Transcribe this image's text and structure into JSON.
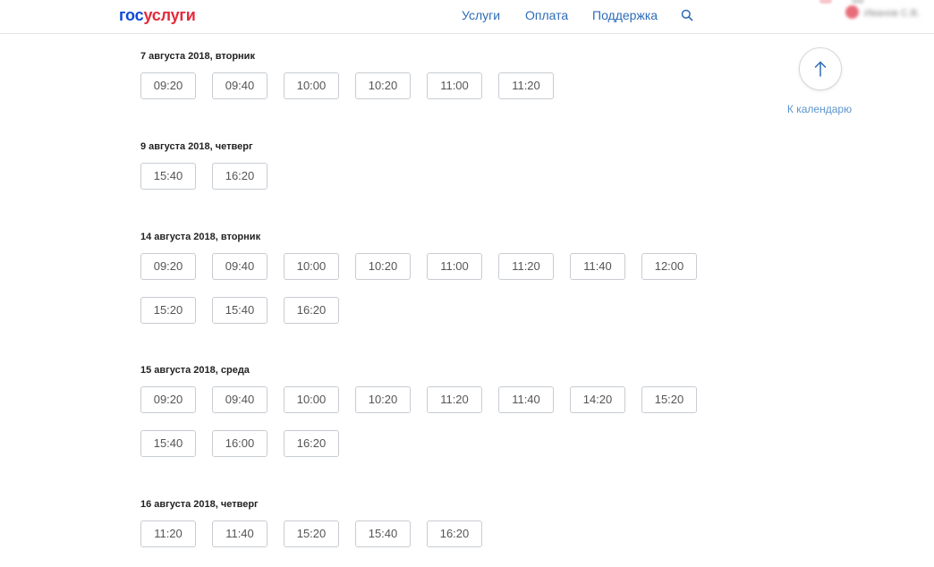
{
  "header": {
    "logo": {
      "part1": "гос",
      "part2": "услуги",
      "part3": ""
    },
    "nav": [
      {
        "label": "Услуги",
        "name": "nav-services"
      },
      {
        "label": "Оплата",
        "name": "nav-payment"
      },
      {
        "label": "Поддержка",
        "name": "nav-support"
      }
    ],
    "user_name": "Иванов С.В."
  },
  "to_calendar": {
    "label": "К календарю"
  },
  "days": [
    {
      "title": "7 августа 2018, вторник",
      "slots": [
        "09:20",
        "09:40",
        "10:00",
        "10:20",
        "11:00",
        "11:20"
      ]
    },
    {
      "title": "9 августа 2018, четверг",
      "slots": [
        "15:40",
        "16:20"
      ]
    },
    {
      "title": "14 августа 2018, вторник",
      "slots": [
        "09:20",
        "09:40",
        "10:00",
        "10:20",
        "11:00",
        "11:20",
        "11:40",
        "12:00",
        "15:20",
        "15:40",
        "16:20"
      ]
    },
    {
      "title": "15 августа 2018, среда",
      "slots": [
        "09:20",
        "09:40",
        "10:00",
        "10:20",
        "11:20",
        "11:40",
        "14:20",
        "15:20",
        "15:40",
        "16:00",
        "16:20"
      ]
    },
    {
      "title": "16 августа 2018, четверг",
      "slots": [
        "11:20",
        "11:40",
        "15:20",
        "15:40",
        "16:20"
      ]
    }
  ],
  "colors": {
    "brand_blue": "#0d4cd3",
    "brand_red": "#e5293a",
    "link": "#2d6bb6",
    "border": "#c8ccd1"
  }
}
